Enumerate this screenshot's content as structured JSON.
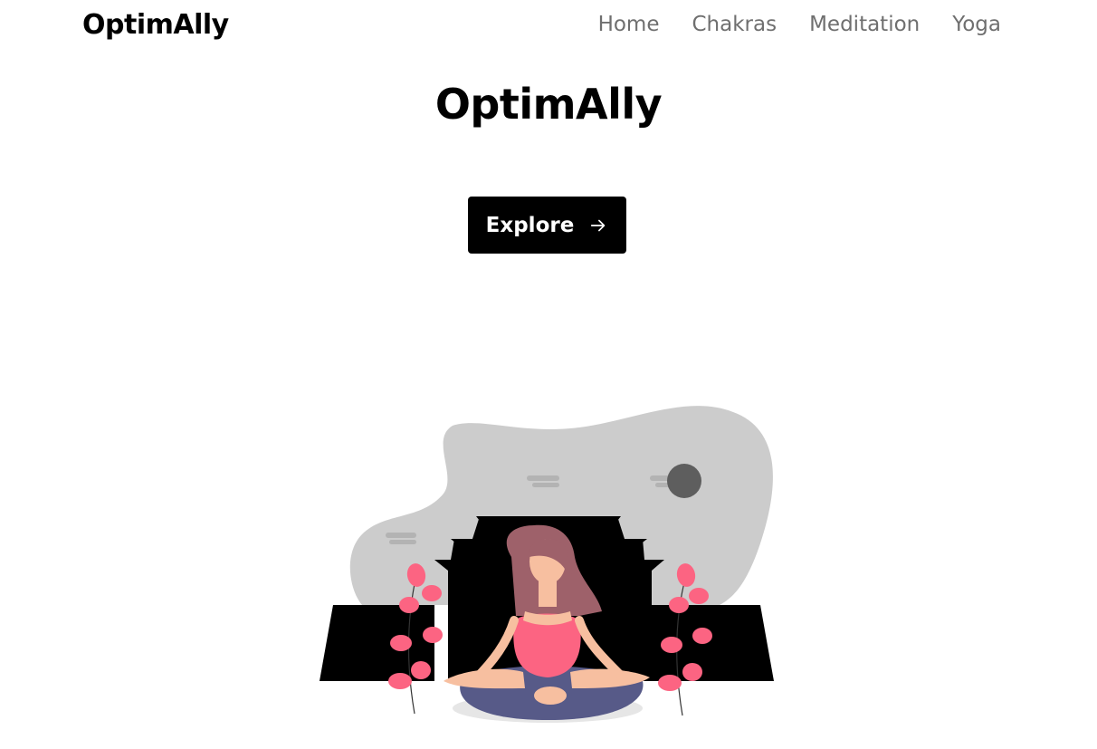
{
  "nav": {
    "brand": "OptimAlly",
    "links": [
      "Home",
      "Chakras",
      "Meditation",
      "Yoga"
    ]
  },
  "hero": {
    "title": "OptimAlly",
    "button_label": "Explore",
    "button_icon": "arrow-right-icon"
  },
  "illustration": {
    "subject": "meditation-woman-temple-illustration",
    "colors": {
      "cloud": "#cccccc",
      "moon": "#5e5e5e",
      "temple": "#000000",
      "shirt": "#fc6482",
      "pants": "#575a88",
      "hair": "#9e616a",
      "skin": "#f7bfa0",
      "leaves": "#fc6482"
    }
  }
}
